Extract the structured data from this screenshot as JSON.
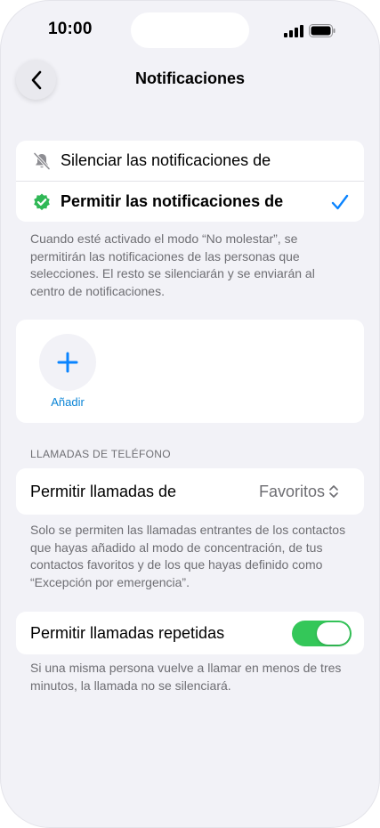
{
  "status_bar": {
    "time": "10:00"
  },
  "nav": {
    "title": "Notificaciones",
    "back_icon": "chevron-left-icon"
  },
  "notification_mode": {
    "options": [
      {
        "label": "Silenciar las notificaciones de",
        "icon": "bell-slash-icon",
        "selected": false
      },
      {
        "label": "Permitir las notificaciones de",
        "icon": "verified-badge-icon",
        "selected": true
      }
    ],
    "footnote": "Cuando esté activado el modo “No molestar”, se permitirán las notificaciones de las personas que selecciones. El resto se silenciarán y se enviarán al centro de notificaciones."
  },
  "people": {
    "add_label": "Añadir",
    "add_icon": "plus-icon"
  },
  "calls": {
    "section_header": "LLAMADAS DE TELÉFONO",
    "allow_calls_label": "Permitir llamadas de",
    "allow_calls_value": "Favoritos",
    "footnote": "Solo se permiten las llamadas entrantes de los contactos que hayas añadido al modo de concentración, de tus contactos favoritos y de los que hayas definido como “Excepción por emergencia”.",
    "repeated_label": "Permitir llamadas repetidas",
    "repeated_enabled": true,
    "repeated_footnote": "Si una misma persona vuelve a llamar en menos de tres minutos, la llamada no se silenciará."
  },
  "colors": {
    "accent": "#0a84ff",
    "toggle_on": "#34c759",
    "verified_green": "#30b856"
  }
}
